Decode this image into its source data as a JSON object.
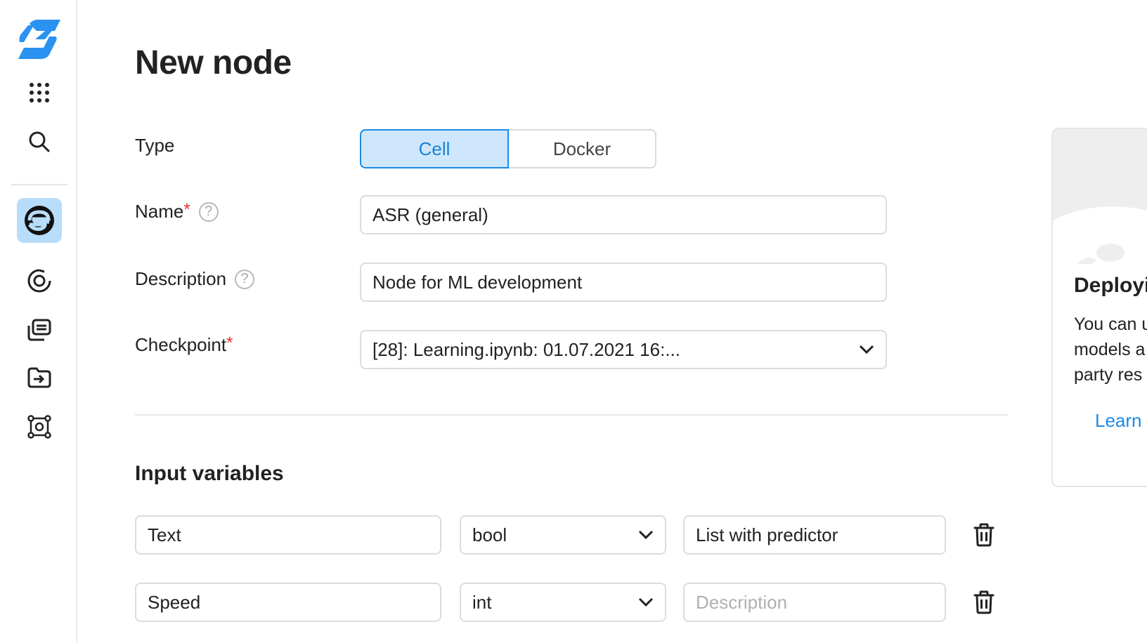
{
  "app": {
    "logo_icon": "brand-logo-icon",
    "accent_color": "#1c8be6"
  },
  "sidebar": {
    "items": [
      {
        "icon": "apps-grid-icon"
      },
      {
        "icon": "search-icon"
      },
      {
        "icon": "datasphere-icon",
        "active": true
      },
      {
        "icon": "target-icon"
      },
      {
        "icon": "resources-icon"
      },
      {
        "icon": "folder-import-icon"
      },
      {
        "icon": "nodes-graph-icon"
      }
    ]
  },
  "page": {
    "title": "New node"
  },
  "form": {
    "type": {
      "label": "Type",
      "options": [
        "Cell",
        "Docker"
      ],
      "selected": "Cell"
    },
    "name": {
      "label": "Name",
      "required": "*",
      "help": "?",
      "value": "ASR (general)"
    },
    "description": {
      "label": "Description",
      "help": "?",
      "value": "Node for ML development"
    },
    "checkpoint": {
      "label": "Checkpoint",
      "required": "*",
      "value": "[28]: Learning.ipynb: 01.07.2021 16:..."
    }
  },
  "input_variables": {
    "title": "Input variables",
    "rows": [
      {
        "name": "Text",
        "type": "bool",
        "description": "List with predictor",
        "description_placeholder": "Description"
      },
      {
        "name": "Speed",
        "type": "int",
        "description": "",
        "description_placeholder": "Description"
      }
    ]
  },
  "promo": {
    "title": "Deployi",
    "text": "You can u\nmodels a\nparty res",
    "link": "Learn"
  }
}
